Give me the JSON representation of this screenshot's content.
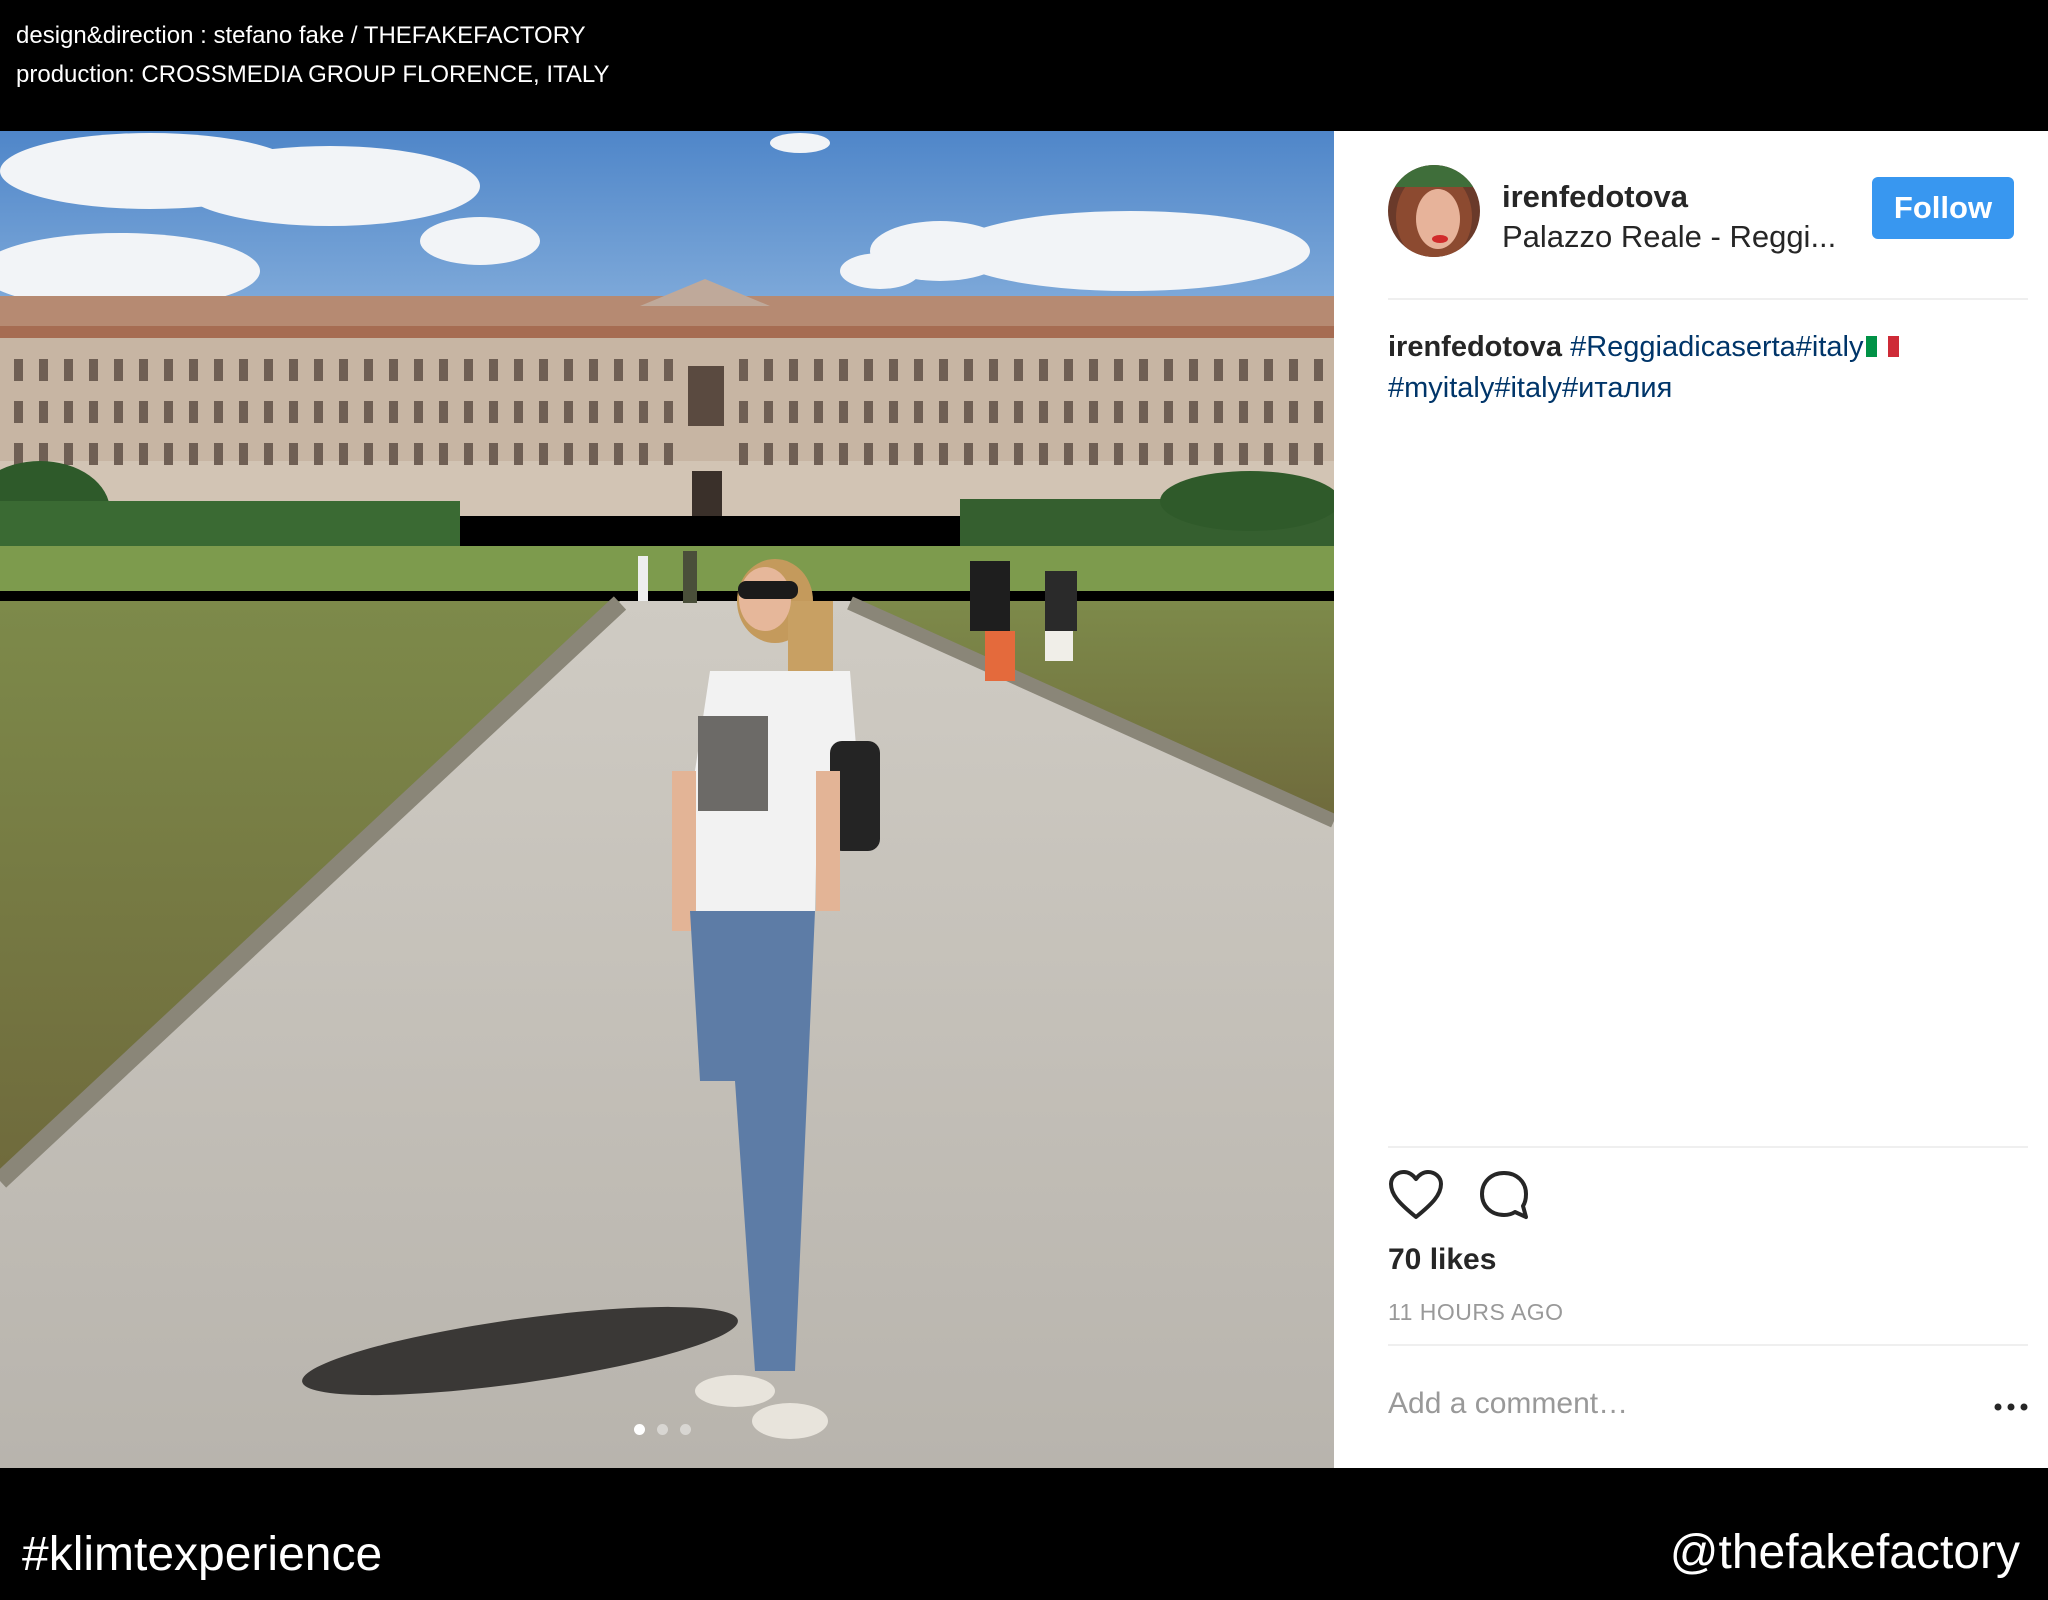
{
  "credits": {
    "line1": "design&direction : stefano fake / THEFAKEFACTORY",
    "line2": "production: CROSSMEDIA GROUP FLORENCE, ITALY"
  },
  "post": {
    "username": "irenfedotova",
    "location": "Palazzo Reale - Reggi...",
    "follow_label": "Follow",
    "caption": {
      "user": "irenfedotova",
      "hashtags_line1": "#Reggiadicaserta#italy",
      "hashtags_line2": "#myitaly#italy#италия"
    },
    "flag_colors": [
      "#009246",
      "#ffffff",
      "#ce2b37"
    ],
    "likes": "70 likes",
    "time": "11 HOURS AGO",
    "comment_placeholder": "Add a comment…",
    "carousel": {
      "count": 3,
      "active": 1
    },
    "icons": {
      "like": "heart-outline-icon",
      "comment": "speech-bubble-icon",
      "more": "ellipsis-icon"
    },
    "colors": {
      "follow_bg": "#3897f0",
      "hashtag": "#003569"
    }
  },
  "footer": {
    "hashtag": "#klimtexperience",
    "handle": "@thefakefactory"
  }
}
